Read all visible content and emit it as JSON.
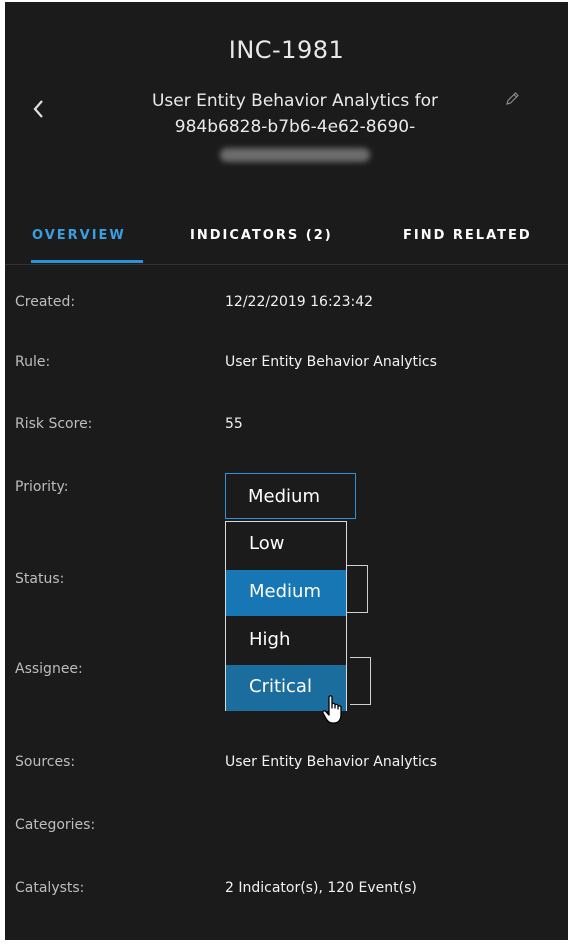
{
  "header": {
    "incident_id": "INC-1981",
    "title_line1": "User Entity Behavior Analytics for",
    "title_line2": "984b6828-b7b6-4e62-8690-",
    "back_icon": "chevron-left-icon",
    "edit_icon": "pencil-icon"
  },
  "tabs": [
    {
      "label": "OVERVIEW",
      "active": true
    },
    {
      "label": "INDICATORS (2)",
      "active": false
    },
    {
      "label": "FIND RELATED",
      "active": false
    }
  ],
  "fields": {
    "created": {
      "label": "Created:",
      "value": "12/22/2019 16:23:42"
    },
    "rule": {
      "label": "Rule:",
      "value": "User Entity Behavior Analytics"
    },
    "risk_score": {
      "label": "Risk Score:",
      "value": "55"
    },
    "priority": {
      "label": "Priority:",
      "value": "Medium"
    },
    "status": {
      "label": "Status:"
    },
    "assignee": {
      "label": "Assignee:"
    },
    "sources": {
      "label": "Sources:",
      "value": "User Entity Behavior Analytics"
    },
    "categories": {
      "label": "Categories:",
      "value": ""
    },
    "catalysts": {
      "label": "Catalysts:",
      "value": "2 Indicator(s), 120 Event(s)"
    }
  },
  "priority_dropdown": {
    "options": [
      "Low",
      "Medium",
      "High",
      "Critical"
    ],
    "selected": "Medium",
    "hovered": "Critical"
  },
  "colors": {
    "background": "#1b1b1b",
    "accent": "#2f90d8",
    "selected_option": "#1776b4"
  }
}
